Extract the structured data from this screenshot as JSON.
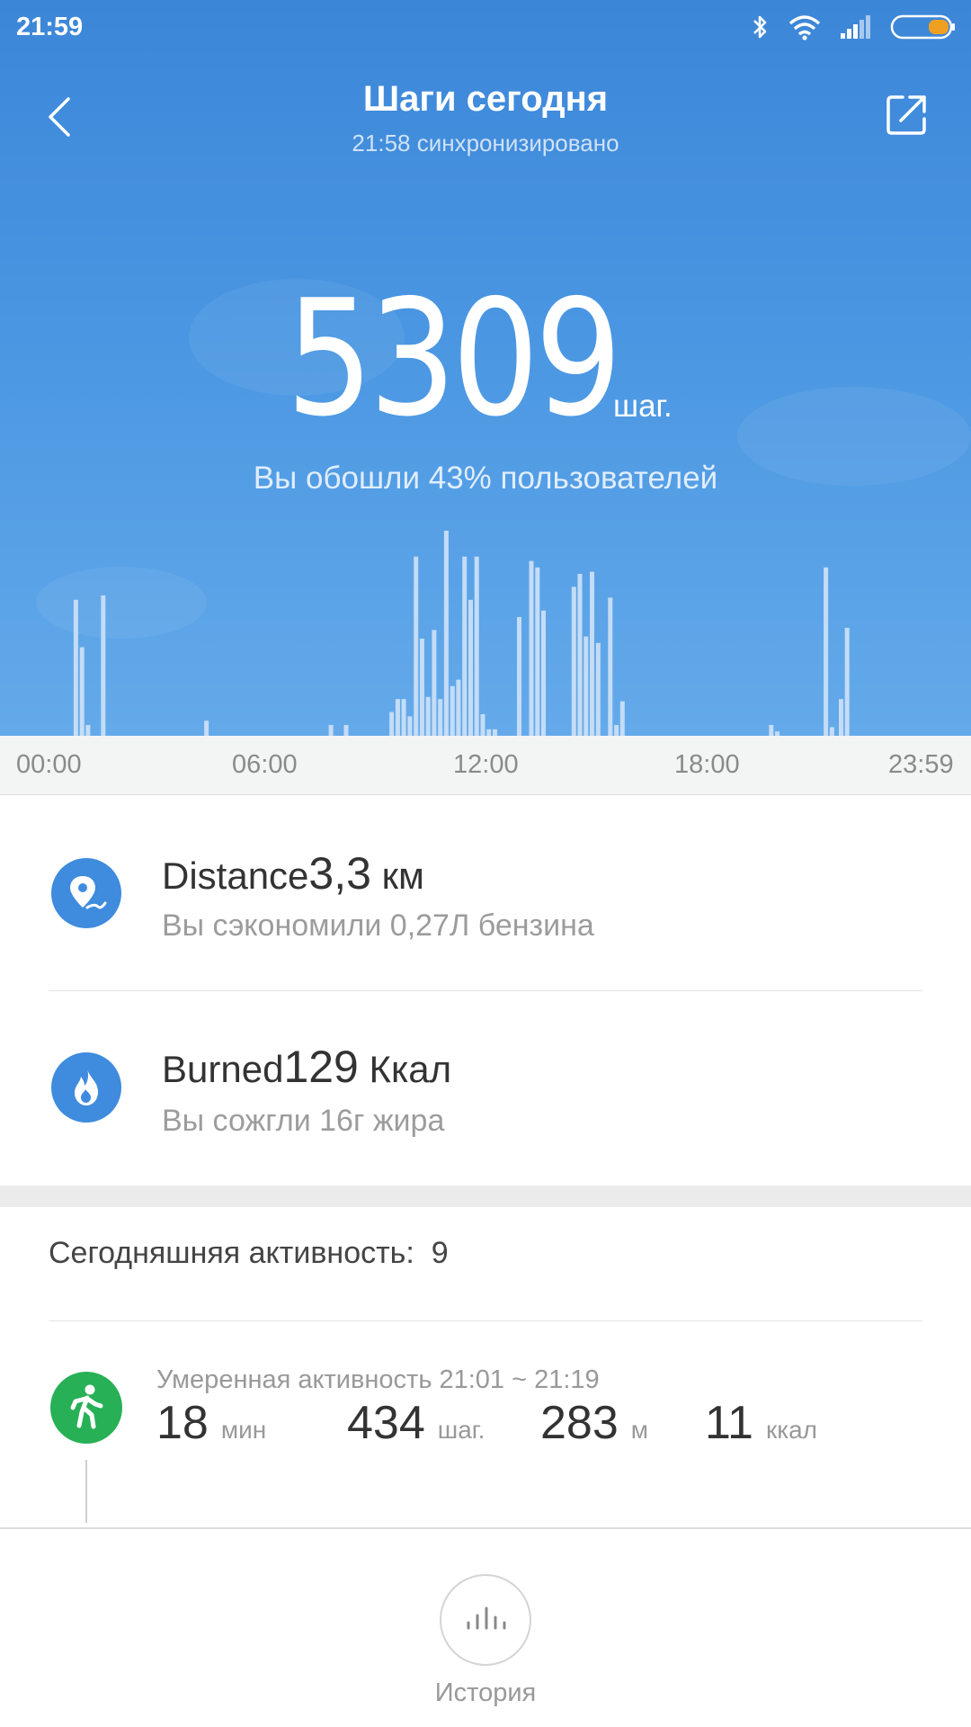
{
  "status_bar": {
    "time": "21:59",
    "icons": [
      "bluetooth-icon",
      "wifi-icon",
      "signal-icon",
      "battery-icon"
    ],
    "battery_color": "#f0a020"
  },
  "header": {
    "title": "Шаги сегодня",
    "sync_text": "21:58 синхронизировано",
    "back_icon": "chevron-left-icon",
    "share_icon": "share-icon"
  },
  "summary": {
    "steps": "5309",
    "steps_unit": "шаг.",
    "rank_text": "Вы обошли 43% пользователей"
  },
  "chart_data": {
    "type": "bar",
    "x_range": [
      "00:00",
      "23:59"
    ],
    "tick_labels": [
      "00:00",
      "06:00",
      "12:00",
      "18:00",
      "23:59"
    ],
    "x": [
      "00:45",
      "00:55",
      "01:05",
      "01:30",
      "04:20",
      "07:45",
      "08:10",
      "09:25",
      "09:35",
      "09:45",
      "09:55",
      "10:05",
      "10:15",
      "10:25",
      "10:35",
      "10:45",
      "10:55",
      "11:05",
      "11:15",
      "11:25",
      "11:35",
      "11:45",
      "11:55",
      "12:05",
      "12:15",
      "12:55",
      "13:15",
      "13:25",
      "13:35",
      "14:25",
      "14:35",
      "14:45",
      "14:55",
      "15:05",
      "15:25",
      "15:35",
      "15:45",
      "19:50",
      "20:00",
      "21:20",
      "21:30",
      "21:45",
      "21:55"
    ],
    "values": [
      63,
      41,
      5,
      65,
      7,
      5,
      5,
      11,
      17,
      17,
      9,
      83,
      45,
      18,
      49,
      17,
      95,
      23,
      26,
      83,
      63,
      83,
      10,
      3,
      3,
      55,
      81,
      78,
      58,
      69,
      75,
      46,
      76,
      43,
      64,
      5,
      16,
      5,
      2,
      78,
      4,
      17,
      50
    ],
    "color": "#c4dcf6"
  },
  "axis_labels": [
    "00:00",
    "06:00",
    "12:00",
    "18:00",
    "23:59"
  ],
  "stats": {
    "distance": {
      "label": "Distance",
      "value": "3,3",
      "unit": "км",
      "note": "Вы сэкономили 0,27Л бензина",
      "icon": "location-pin-icon",
      "color": "#3f8bde"
    },
    "burned": {
      "label": "Burned",
      "value": "129",
      "unit": "Ккал",
      "note": "Вы сожгли 16г жира",
      "icon": "flame-icon",
      "color": "#3f8bde"
    }
  },
  "activity": {
    "title": "Сегодняшняя активность:",
    "count": "9",
    "items": [
      {
        "label": "Умеренная активность 21:01 ~ 21:19",
        "icon": "walking-person-icon",
        "color": "#27b056",
        "duration": "18",
        "duration_unit": "мин",
        "steps": "434",
        "steps_unit": "шаг.",
        "distance": "283",
        "distance_unit": "м",
        "calories": "11",
        "calories_unit": "ккал"
      }
    ]
  },
  "bottom_nav": {
    "history_label": "История",
    "history_icon": "bar-chart-icon"
  }
}
